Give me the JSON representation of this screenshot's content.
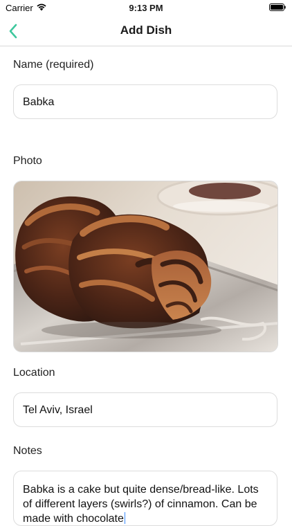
{
  "status_bar": {
    "carrier": "Carrier",
    "time": "9:13 PM",
    "icons": [
      "wifi-icon",
      "battery-icon"
    ]
  },
  "nav": {
    "title": "Add Dish",
    "back_icon": "chevron-left-icon",
    "accent": "#3ec79d"
  },
  "form": {
    "name_label": "Name (required)",
    "name_value": "Babka",
    "photo_label": "Photo",
    "location_label": "Location",
    "location_value": "Tel Aviv, Israel",
    "notes_label": "Notes",
    "notes_value": "Babka is a cake but quite dense/bread-like. Lots of different layers (swirls?) of cinnamon. Can be made with chocolate"
  }
}
